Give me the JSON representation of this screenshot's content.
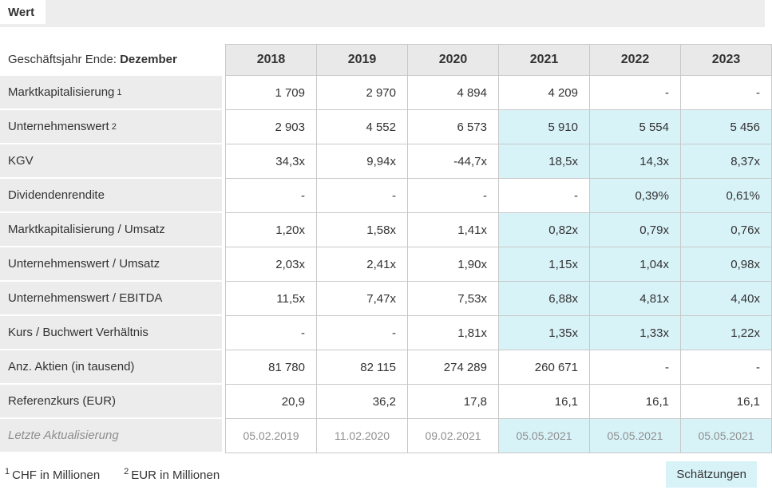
{
  "tabbar": {
    "active_tab": "Wert"
  },
  "table": {
    "header_label": {
      "prefix": "Geschäftsjahr Ende:",
      "bold": "Dezember"
    },
    "years": [
      "2018",
      "2019",
      "2020",
      "2021",
      "2022",
      "2023"
    ],
    "rows": [
      {
        "label": "Marktkapitalisierung",
        "sup": "1",
        "muted": false,
        "values": [
          "1 709",
          "2 970",
          "4 894",
          "4 209",
          "-",
          "-"
        ],
        "highlight": [
          false,
          false,
          false,
          false,
          false,
          false
        ]
      },
      {
        "label": "Unternehmenswert",
        "sup": "2",
        "muted": false,
        "values": [
          "2 903",
          "4 552",
          "6 573",
          "5 910",
          "5 554",
          "5 456"
        ],
        "highlight": [
          false,
          false,
          false,
          true,
          true,
          true
        ]
      },
      {
        "label": "KGV",
        "muted": false,
        "values": [
          "34,3x",
          "9,94x",
          "-44,7x",
          "18,5x",
          "14,3x",
          "8,37x"
        ],
        "highlight": [
          false,
          false,
          false,
          true,
          true,
          true
        ]
      },
      {
        "label": "Dividendenrendite",
        "muted": false,
        "values": [
          "-",
          "-",
          "-",
          "-",
          "0,39%",
          "0,61%"
        ],
        "highlight": [
          false,
          false,
          false,
          false,
          true,
          true
        ]
      },
      {
        "label": "Marktkapitalisierung / Umsatz",
        "muted": false,
        "values": [
          "1,20x",
          "1,58x",
          "1,41x",
          "0,82x",
          "0,79x",
          "0,76x"
        ],
        "highlight": [
          false,
          false,
          false,
          true,
          true,
          true
        ]
      },
      {
        "label": "Unternehmenswert / Umsatz",
        "muted": false,
        "values": [
          "2,03x",
          "2,41x",
          "1,90x",
          "1,15x",
          "1,04x",
          "0,98x"
        ],
        "highlight": [
          false,
          false,
          false,
          true,
          true,
          true
        ]
      },
      {
        "label": "Unternehmenswert / EBITDA",
        "muted": false,
        "values": [
          "11,5x",
          "7,47x",
          "7,53x",
          "6,88x",
          "4,81x",
          "4,40x"
        ],
        "highlight": [
          false,
          false,
          false,
          true,
          true,
          true
        ]
      },
      {
        "label": "Kurs / Buchwert Verhältnis",
        "muted": false,
        "values": [
          "-",
          "-",
          "1,81x",
          "1,35x",
          "1,33x",
          "1,22x"
        ],
        "highlight": [
          false,
          false,
          false,
          true,
          true,
          true
        ]
      },
      {
        "label": "Anz. Aktien (in tausend)",
        "muted": false,
        "values": [
          "81 780",
          "82 115",
          "274 289",
          "260 671",
          "-",
          "-"
        ],
        "highlight": [
          false,
          false,
          false,
          false,
          false,
          false
        ]
      },
      {
        "label": "Referenzkurs (EUR)",
        "muted": false,
        "values": [
          "20,9",
          "36,2",
          "17,8",
          "16,1",
          "16,1",
          "16,1"
        ],
        "highlight": [
          false,
          false,
          false,
          false,
          false,
          false
        ]
      },
      {
        "label": "Letzte Aktualisierung",
        "muted": true,
        "values": [
          "05.02.2019",
          "11.02.2020",
          "09.02.2021",
          "05.05.2021",
          "05.05.2021",
          "05.05.2021"
        ],
        "highlight": [
          false,
          false,
          false,
          true,
          true,
          true
        ]
      }
    ]
  },
  "footnotes": [
    {
      "sup": "1",
      "text": "CHF in Millionen"
    },
    {
      "sup": "2",
      "text": "EUR in Millionen"
    }
  ],
  "legend": {
    "estimates": "Schätzungen"
  },
  "colors": {
    "estimate_highlight": "#d8f3f8",
    "label_bg": "#ececec",
    "header_bg": "#e9e9e9",
    "tabbar_bg": "#ededed",
    "border": "#c9c9c9",
    "muted_text": "#8e8e8e",
    "text": "#333333"
  }
}
